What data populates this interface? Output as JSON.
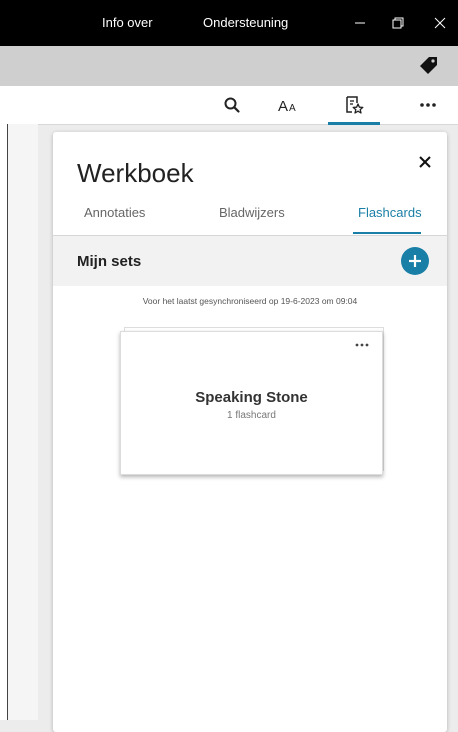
{
  "titlebar": {
    "menu": [
      "Info over",
      "Ondersteuning"
    ],
    "window_buttons": [
      "minimize-icon",
      "restore-icon",
      "close-icon"
    ]
  },
  "toolbar": {
    "icons": [
      "search-icon",
      "font-size-icon",
      "notebook-star-icon",
      "more-icon"
    ],
    "active": "notebook-star-icon",
    "accent": "#1a7fa6"
  },
  "panel": {
    "title": "Werkboek",
    "tabs": [
      "Annotaties",
      "Bladwijzers",
      "Flashcards"
    ],
    "active_tab": "Flashcards",
    "sets_title": "Mijn sets",
    "sync_text": "Voor het laatst gesynchroniseerd op 19-6-2023 om 09:04",
    "cards": [
      {
        "title": "Speaking Stone",
        "count": "1 flashcard"
      }
    ]
  }
}
